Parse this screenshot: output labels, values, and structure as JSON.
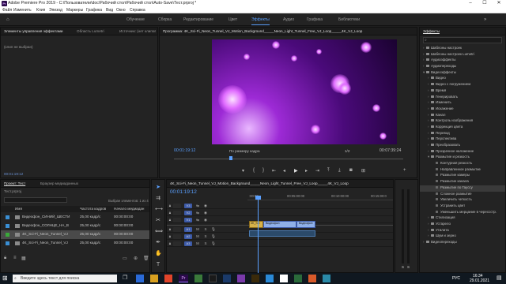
{
  "app": {
    "title": "Adobe Premiere Pro 2019 - C:\\Пользователи\\doc\\Рабочий стол\\Рабочий стол\\Auto-Save\\Тест.prproj *"
  },
  "menu": [
    "Файл",
    "Изменить",
    "Клип",
    "Эпизод",
    "Маркеры",
    "Графика",
    "Вид",
    "Окно",
    "Справка"
  ],
  "workspaces": [
    "Обучение",
    "Сборка",
    "Редактирование",
    "Цвет",
    "Эффекты",
    "Аудио",
    "Графика",
    "Библиотеки"
  ],
  "workspace_active": "Эффекты",
  "effect_controls": {
    "tabs": [
      "Элементы управления эффектами",
      "Область Lumetri",
      "Источник: (нет клипов)",
      "Микшер аудиоклипа: 4K_Sci-Fi..."
    ],
    "empty_text": "(клип не выбран)",
    "timecode": "00:01:19:12"
  },
  "program": {
    "tab": "Программа: 4K_Sci-Fi_Neon_Tunnel_VJ_Motion_Background_____Neon_Light_Tunnel_Free_VJ_Loop_____4K_VJ_Loop",
    "timecode_left": "00:01:19:12",
    "fit": "По размеру кадра",
    "scale": "1/2",
    "timecode_right": "00:07:39:24"
  },
  "effects": {
    "title": "Эффекты",
    "items": [
      {
        "label": "Шаблоны настроек",
        "level": 0,
        "open": false
      },
      {
        "label": "Шаблоны настроек Lumetri",
        "level": 0,
        "open": false
      },
      {
        "label": "Аудиоэффекты",
        "level": 0,
        "open": false
      },
      {
        "label": "Аудиопереходы",
        "level": 0,
        "open": false
      },
      {
        "label": "Видеоэффекты",
        "level": 0,
        "open": true
      },
      {
        "label": "Видео",
        "level": 1,
        "open": false
      },
      {
        "label": "Видео с погружением",
        "level": 1,
        "open": false
      },
      {
        "label": "Время",
        "level": 1,
        "open": false
      },
      {
        "label": "Генерировать",
        "level": 1,
        "open": false
      },
      {
        "label": "Изменить",
        "level": 1,
        "open": false
      },
      {
        "label": "Искажение",
        "level": 1,
        "open": false
      },
      {
        "label": "Канал",
        "level": 1,
        "open": false
      },
      {
        "label": "Контроль изображения",
        "level": 1,
        "open": false
      },
      {
        "label": "Коррекция цвета",
        "level": 1,
        "open": false
      },
      {
        "label": "Перевод",
        "level": 1,
        "open": false
      },
      {
        "label": "Перспектива",
        "level": 1,
        "open": false
      },
      {
        "label": "Преобразовать",
        "level": 1,
        "open": false
      },
      {
        "label": "Прозрачное наложение",
        "level": 1,
        "open": false
      },
      {
        "label": "Размытие и резкость",
        "level": 1,
        "open": true
      },
      {
        "label": "Контурная резкость",
        "level": 2,
        "open": false
      },
      {
        "label": "Направленное размытие",
        "level": 2,
        "open": false
      },
      {
        "label": "Размытие камеры",
        "level": 2,
        "open": false
      },
      {
        "label": "Размытие канала",
        "level": 2,
        "open": false
      },
      {
        "label": "Размытие по Гауссу",
        "level": 2,
        "open": false,
        "selected": true
      },
      {
        "label": "Сложное размытие",
        "level": 2,
        "open": false
      },
      {
        "label": "Увеличить четкость",
        "level": 2,
        "open": false
      },
      {
        "label": "Устранить цвет",
        "level": 2,
        "open": false
      },
      {
        "label": "Уменьшить мерцание в черессстр.",
        "level": 2,
        "open": false
      },
      {
        "label": "Стилизация",
        "level": 1,
        "open": false
      },
      {
        "label": "Устарело",
        "level": 1,
        "open": false
      },
      {
        "label": "Утилита",
        "level": 1,
        "open": false
      },
      {
        "label": "Шум и зерно",
        "level": 1,
        "open": false
      },
      {
        "label": "Видеопереходы",
        "level": 0,
        "open": false
      }
    ]
  },
  "project": {
    "tabs": [
      "Проект: Тест",
      "Браузер медиаданных"
    ],
    "name": "Тест.prproj",
    "selection": "Выбран элементов: 1 из 4",
    "columns": [
      "Имя",
      "Частота кадров",
      "Начало медиадан"
    ],
    "rows": [
      {
        "color": "#3a8fd4",
        "name": "Видеофон_СИНИЙ_ШЕСТИ",
        "fps": "25,00 кадр/с",
        "start": "00:00:00:00"
      },
      {
        "color": "#3a8fd4",
        "name": "Видеофон_СОЛНЦЕ_НА_В",
        "fps": "25,00 кадр/с",
        "start": "00:00:00:00"
      },
      {
        "color": "#3aa83a",
        "name": "4K_Sci-Fi_Neon_Tunnel_VJ",
        "fps": "25,00 кадр/с",
        "start": "00:00:00:00",
        "selected": true
      },
      {
        "color": "#3a8fd4",
        "name": "4K_Sci-Fi_Neon_Tunnel_VJ",
        "fps": "25,00 кадр/с",
        "start": "00:00:00:00"
      }
    ]
  },
  "timeline": {
    "tab": "4K_Sci-Fi_Neon_Tunnel_VJ_Motion_Background_____Neon_Light_Tunnel_Free_VJ_Loop_____4K_VJ_Loop",
    "timecode": "00:01:19:12",
    "ruler": [
      ":00:00",
      "00:05:00:00",
      "00:10:00:00",
      "00:15:00:0"
    ],
    "video_tracks": [
      "V3",
      "V2",
      "V1"
    ],
    "audio_tracks": [
      "A1",
      "A2",
      "A3"
    ],
    "clips": [
      {
        "label": "4K_Sci",
        "track": "V1",
        "kind": "video"
      },
      {
        "label": "Видеофон",
        "track": "V1",
        "kind": "video"
      },
      {
        "label": "Видеофон",
        "track": "V1",
        "kind": "video"
      }
    ]
  },
  "meter": {
    "labels": [
      "S",
      "S"
    ]
  },
  "taskbar": {
    "search_placeholder": "Введите здесь текст для поиска",
    "lang": "РУС",
    "time": "16:34",
    "date": "29.01.2021"
  }
}
